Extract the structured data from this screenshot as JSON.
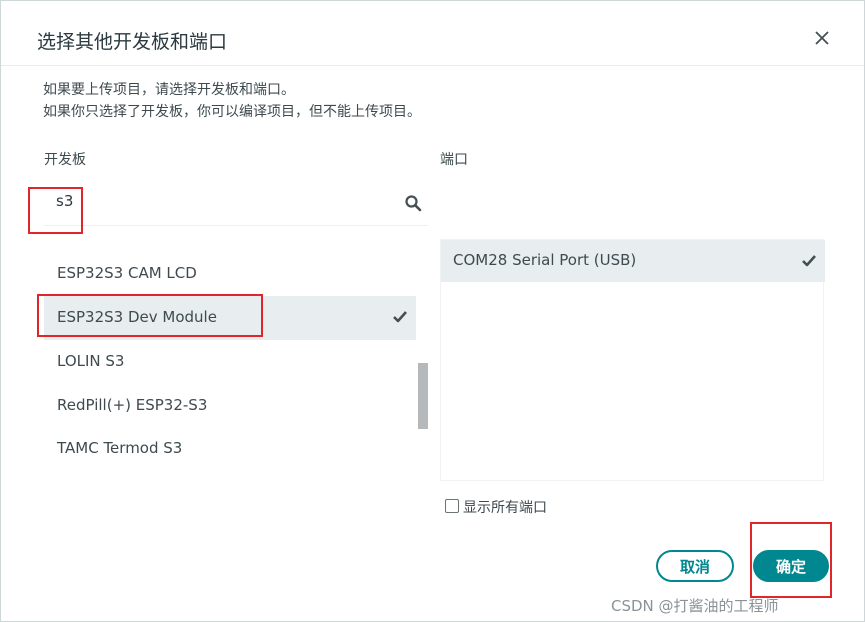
{
  "dialog": {
    "title": "选择其他开发板和端口",
    "info_line1": "如果要上传项目，请选择开发板和端口。",
    "info_line2": "如果你只选择了开发板，你可以编译项目，但不能上传项目。"
  },
  "boards": {
    "label": "开发板",
    "search_value": "s3",
    "items": [
      {
        "label": "ESP32S3 CAM LCD",
        "selected": false
      },
      {
        "label": "ESP32S3 Dev Module",
        "selected": true
      },
      {
        "label": "LOLIN S3",
        "selected": false
      },
      {
        "label": "RedPill(+) ESP32-S3",
        "selected": false
      },
      {
        "label": "TAMC Termod S3",
        "selected": false
      }
    ]
  },
  "ports": {
    "label": "端口",
    "items": [
      {
        "label": "COM28 Serial Port (USB)",
        "selected": true
      }
    ],
    "show_all_label": "显示所有端口",
    "show_all_checked": false
  },
  "buttons": {
    "cancel": "取消",
    "ok": "确定"
  },
  "watermark": "CSDN @打酱油的工程师",
  "colors": {
    "accent": "#00878f",
    "selected_row": "#e8eef0",
    "annotation_box": "#e0262b"
  },
  "icons": [
    "close-icon",
    "search-icon",
    "check-icon"
  ]
}
